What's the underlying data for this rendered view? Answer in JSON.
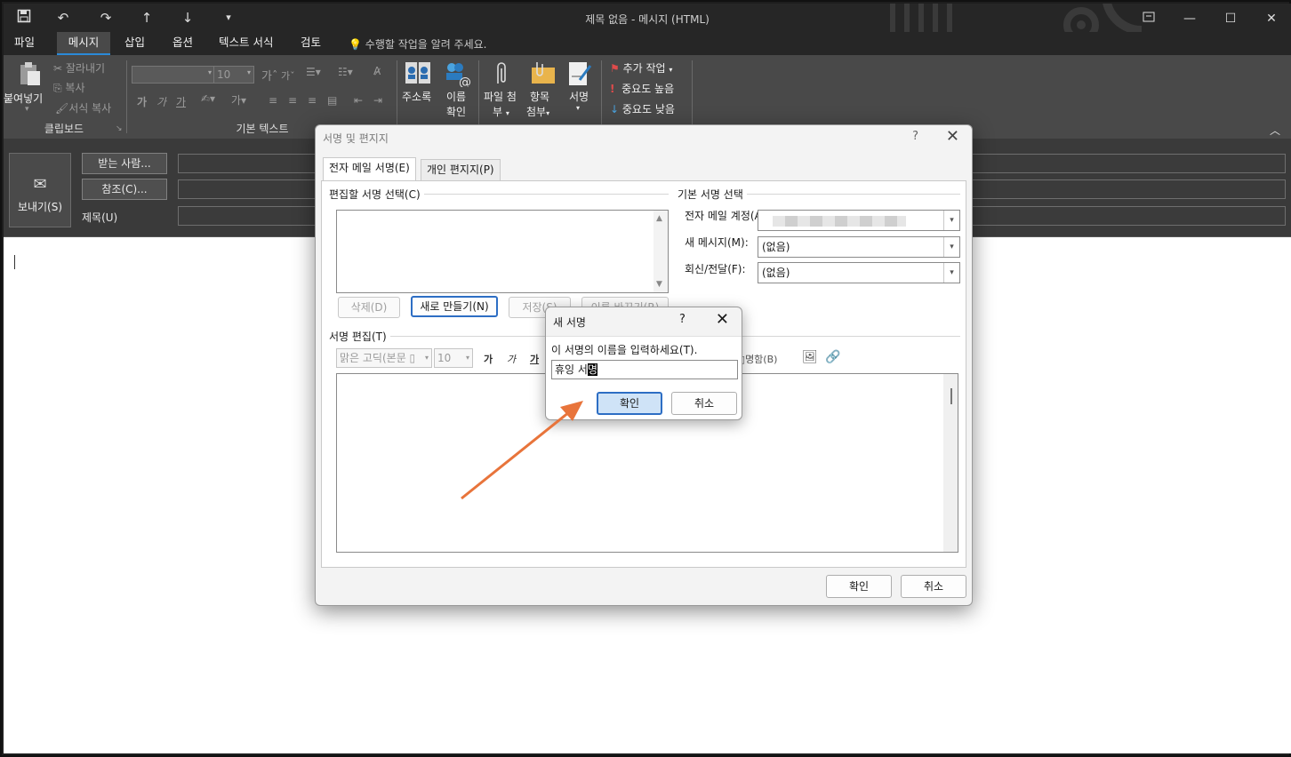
{
  "window": {
    "title": "제목 없음 - 메시지 (HTML)",
    "qat": {
      "save": "💾",
      "undo": "↶",
      "redo": "↷",
      "up": "↑",
      "down": "↓",
      "more": "▾"
    }
  },
  "tabs": [
    "파일",
    "메시지",
    "삽입",
    "옵션",
    "텍스트 서식",
    "검토"
  ],
  "active_tab": "메시지",
  "tell_me": "수행할 작업을 알려 주세요.",
  "ribbon": {
    "clipboard": {
      "paste": "붙여넣기",
      "cut": "잘라내기",
      "copy": "복사",
      "format_painter": "서식 복사",
      "label": "클립보드"
    },
    "basic_text": {
      "font_size": "10",
      "bold": "가",
      "italic": "가",
      "underline": "가",
      "label": "기본 텍스트"
    },
    "names": {
      "address_book": "주소록",
      "check_names_1": "이름",
      "check_names_2": "확인"
    },
    "include": {
      "attach_file_1": "파일 첨",
      "attach_file_2": "부",
      "attach_item_1": "항목",
      "attach_item_2": "첨부",
      "signature": "서명"
    },
    "tags": {
      "follow_up": "추가 작업",
      "high_importance": "중요도 높음",
      "low_importance": "중요도 낮음"
    }
  },
  "compose": {
    "send": "보내기(S)",
    "to_button": "받는 사람...",
    "cc_button": "참조(C)...",
    "subject_label": "제목(U)"
  },
  "signature_dialog": {
    "title": "서명 및 편지지",
    "help": "?",
    "close": "✕",
    "tab_email_signature": "전자 메일 서명(E)",
    "tab_personal_stationery": "개인 편지지(P)",
    "select_signature_label": "편집할 서명 선택(C)",
    "default_signature_label": "기본 서명 선택",
    "email_account_label": "전자 메일 계정(A):",
    "new_messages_label": "새 메시지(M):",
    "new_messages_value": "(없음)",
    "replies_label": "회신/전달(F):",
    "replies_value": "(없음)",
    "delete_button": "삭제(D)",
    "new_button": "새로 만들기(N)",
    "save_button": "저장(S)",
    "rename_button": "이름 바꾸기(R)",
    "edit_signature_label": "서명 편집(T)",
    "font_value": "맑은 고딕(본문 ▯",
    "font_size_value": "10",
    "bold": "가",
    "italic": "가",
    "underline": "가",
    "business_card": "명함(B)",
    "ok_button": "확인",
    "cancel_button": "취소"
  },
  "new_signature_popup": {
    "title": "새 서명",
    "help": "?",
    "close": "✕",
    "prompt": "이 서명의 이름을 입력하세요(T).",
    "input_value_plain": "휴잉 서",
    "input_value_selected": "명",
    "ok_button": "확인",
    "cancel_button": "취소"
  },
  "colors": {
    "accent": "#2b8ad8",
    "arrow": "#e8743b",
    "ribbon_bg": "#494949",
    "titlebar_bg": "#262626"
  }
}
